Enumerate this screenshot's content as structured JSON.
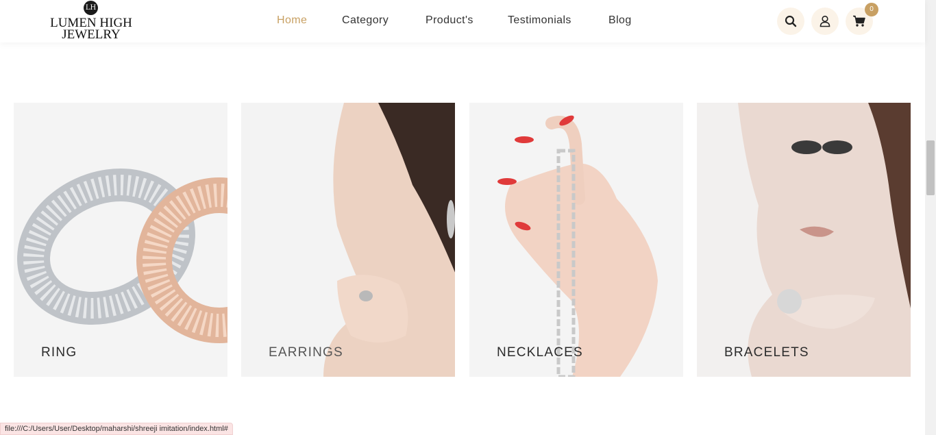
{
  "brand": {
    "monogram": "LH",
    "line1": "LUMEN HIGH",
    "line2": "JEWELRY"
  },
  "nav": {
    "items": [
      "Home",
      "Category",
      "Product's",
      "Testimonials",
      "Blog"
    ],
    "active": "Home"
  },
  "header_icons": {
    "search": "search-icon",
    "account": "user-icon",
    "cart": "cart-icon",
    "cart_count": "0"
  },
  "colors": {
    "accent": "#c8a063",
    "icon_bg": "#fbf3e8",
    "card_bg": "#f4f4f4"
  },
  "categories": [
    {
      "label": "RING",
      "image": "rings-image"
    },
    {
      "label": "EARRINGS",
      "image": "earrings-model-image"
    },
    {
      "label": "NECKLACES",
      "image": "necklace-hand-image"
    },
    {
      "label": "BRACELETS",
      "image": "bracelet-model-image"
    }
  ],
  "status_bar": {
    "url": "file:///C:/Users/User/Desktop/maharshi/shreeji imitation/index.html#"
  }
}
